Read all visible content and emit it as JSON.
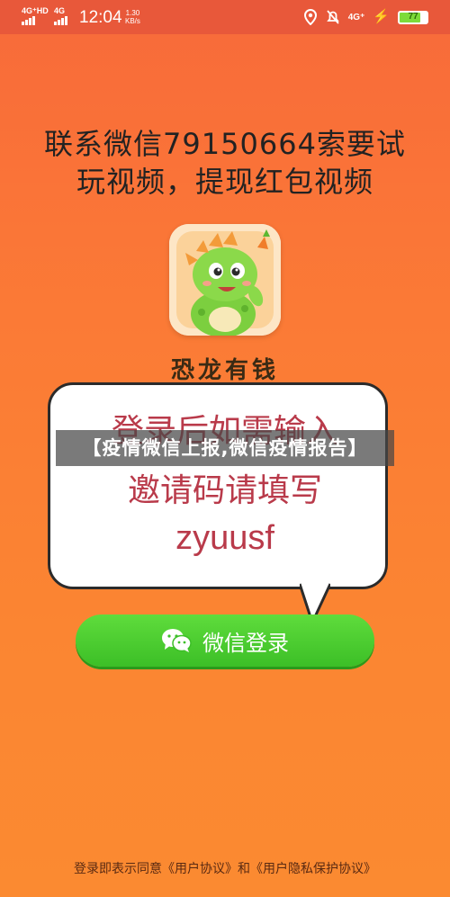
{
  "status_bar": {
    "network_1": "4G⁺HD",
    "network_2": "4G",
    "time": "12:04",
    "speed_value": "1.30",
    "speed_unit": "KB/s",
    "network_3": "4G⁺",
    "battery": "77",
    "battery_level": 0.77
  },
  "headline": {
    "line1": "联系微信79150664索要试",
    "line2": "玩视频，提现红包视频"
  },
  "app": {
    "name": "恐龙有钱",
    "icon": "dinosaur-mascot-icon"
  },
  "bubble": {
    "line1": "登录后如需输入",
    "line2": "邀请码请填写",
    "code": "zyuusf"
  },
  "banner": "【疫情微信上报,微信疫情报告】",
  "login_button": "微信登录",
  "footer": "登录即表示同意《用户协议》和《用户隐私保护协议》",
  "colors": {
    "background": "#fb7a36",
    "status_bar": "#e8583a",
    "button_green": "#3cbf27",
    "bubble_text": "#b93a4a"
  }
}
